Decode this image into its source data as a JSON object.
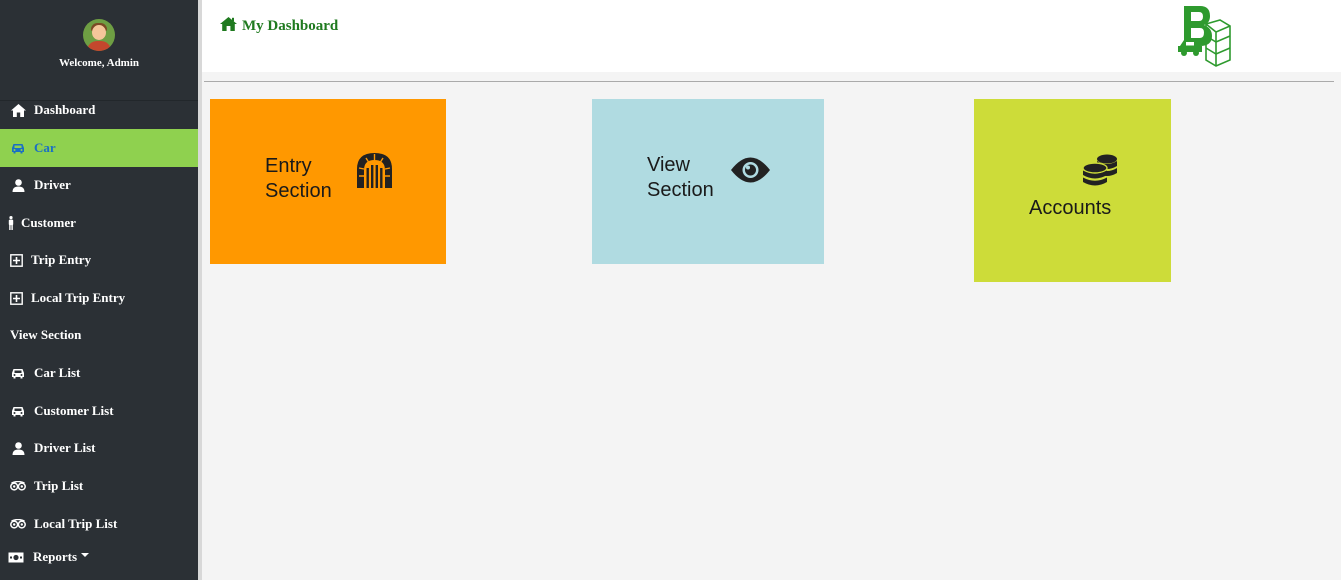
{
  "sidebar": {
    "welcome": "Welcome, Admin",
    "items": [
      {
        "label": "Dashboard"
      },
      {
        "label": "Car"
      },
      {
        "label": "Driver"
      },
      {
        "label": "Customer"
      },
      {
        "label": "Trip Entry"
      },
      {
        "label": "Local Trip Entry"
      }
    ],
    "view_heading": "View Section",
    "view_items": [
      {
        "label": "Car List"
      },
      {
        "label": "Customer List"
      },
      {
        "label": "Driver List"
      },
      {
        "label": "Trip List"
      },
      {
        "label": "Local Trip List"
      },
      {
        "label": "Reports"
      }
    ]
  },
  "header": {
    "title": "My Dashboard"
  },
  "tiles": {
    "entry": {
      "line1": "Entry",
      "line2": "Section"
    },
    "view": {
      "line1": "View",
      "line2": "Section"
    },
    "accounts": {
      "label": "Accounts"
    }
  },
  "colors": {
    "sidebar_bg": "#2b3035",
    "active_item": "#8fd14f",
    "active_text": "#1a6fc4",
    "title_green": "#1f7a1f",
    "tile_entry": "#ff9800",
    "tile_view": "#b0dbe1",
    "tile_accounts": "#cddc39"
  },
  "icons": {
    "dashboard": "home-icon",
    "car": "car-icon",
    "driver": "user-icon",
    "customer": "person-standing-icon",
    "trip_entry": "plus-square-icon",
    "local_trip_entry": "plus-square-icon",
    "car_list": "car-icon",
    "customer_list": "car-icon",
    "driver_list": "user-icon",
    "trip_list": "tripadvisor-icon",
    "local_trip_list": "tripadvisor-icon",
    "reports": "money-icon",
    "entry_tile": "gate-icon",
    "view_tile": "eye-icon",
    "accounts_tile": "coins-icon"
  }
}
